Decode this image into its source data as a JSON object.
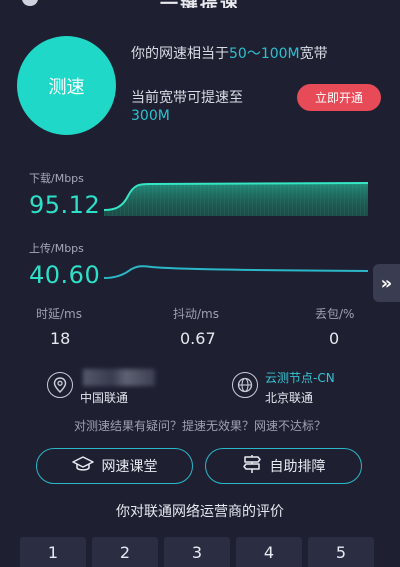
{
  "header": {
    "title": "一键提速"
  },
  "speed_test": {
    "button_label": "测速",
    "equivalent_prefix": "你的网速相当于",
    "equivalent_value": "50～100M",
    "equivalent_suffix": "宽带",
    "boost_prefix": "当前宽带可提速至",
    "boost_value": "300M",
    "boost_button": "立即开通"
  },
  "download": {
    "label": "下载/Mbps",
    "value": "95.12",
    "color": "#2de0c8"
  },
  "upload": {
    "label": "上传/Mbps",
    "value": "40.60",
    "color": "#2bb7c7"
  },
  "side_arrow": "»",
  "stats": [
    {
      "label": "时延/ms",
      "value": "18"
    },
    {
      "label": "抖动/ms",
      "value": "0.67"
    },
    {
      "label": "丢包/%",
      "value": "0"
    }
  ],
  "isp": {
    "name": "中国联通",
    "icon": "location-pin-icon"
  },
  "node": {
    "title": "云测节点-CN",
    "name": "北京联通",
    "icon": "globe-icon"
  },
  "question": "对测速结果有疑问？提速无效果？网速不达标？",
  "buttons": {
    "course": {
      "label": "网速课堂",
      "icon": "graduation-cap-icon"
    },
    "troubleshoot": {
      "label": "自助排障",
      "icon": "signpost-icon"
    }
  },
  "rating": {
    "title": "你对联通网络运营商的评价",
    "options": [
      "1",
      "2",
      "3",
      "4",
      "5"
    ]
  }
}
